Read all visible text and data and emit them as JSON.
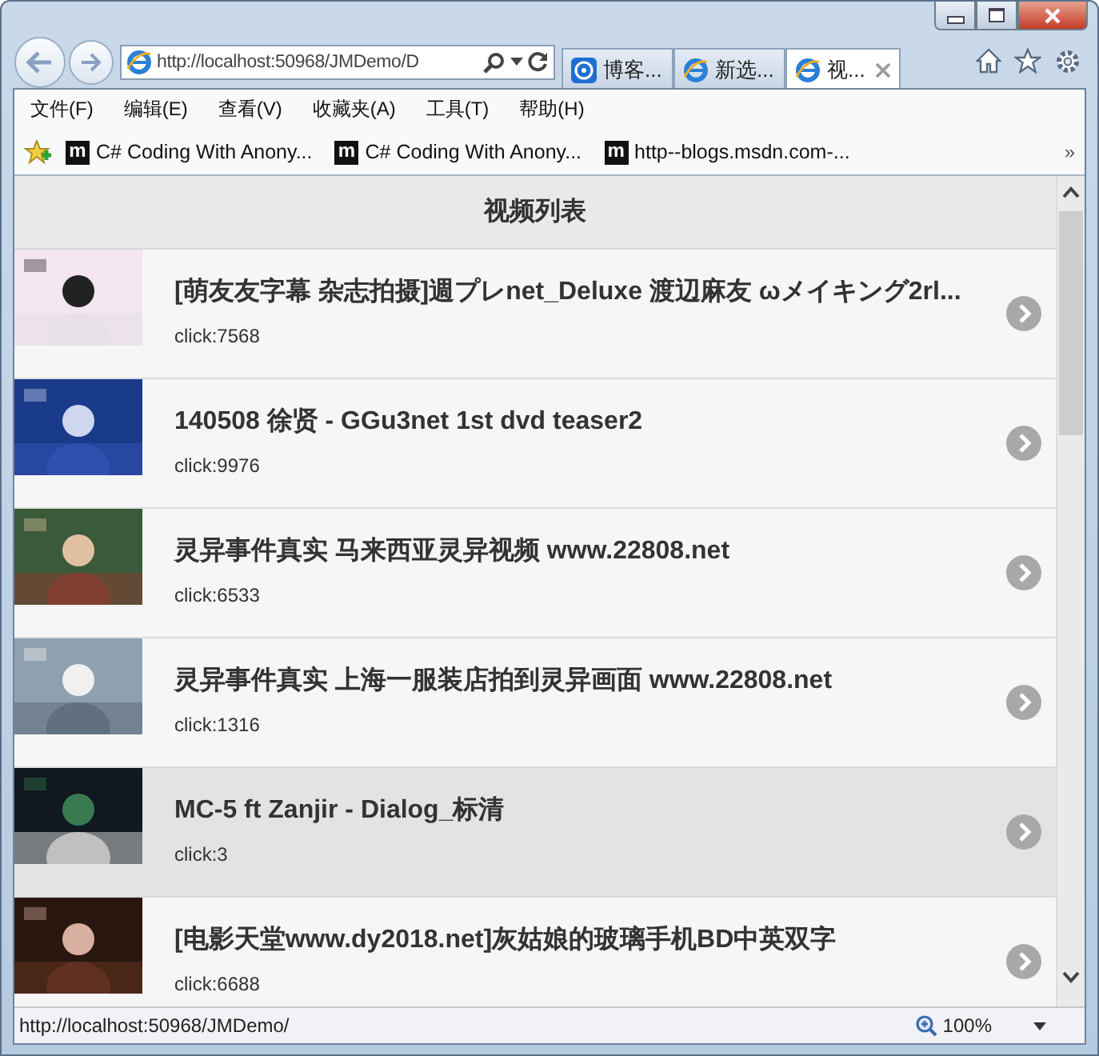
{
  "address_bar": {
    "value": "http://localhost:50968/JMDemo/D"
  },
  "tabs": [
    {
      "label": "博客...",
      "kind": "site",
      "selected": false
    },
    {
      "label": "新选...",
      "kind": "ie",
      "selected": false
    },
    {
      "label": "视...",
      "kind": "ie",
      "selected": true
    }
  ],
  "menu": [
    "文件(F)",
    "编辑(E)",
    "查看(V)",
    "收藏夹(A)",
    "工具(T)",
    "帮助(H)"
  ],
  "favorites": {
    "items": [
      {
        "icon": "m",
        "label": "C# Coding With Anony..."
      },
      {
        "icon": "m",
        "label": "C# Coding With Anony..."
      },
      {
        "icon": "m",
        "label": "http--blogs.msdn.com-..."
      }
    ],
    "overflow": "»"
  },
  "page": {
    "title": "视频列表",
    "videos": [
      {
        "title": "[萌友友字幕 杂志拍摄]週プレnet_Deluxe 渡辺麻友 ωメイキング2rl...",
        "clicks": "click:7568",
        "highlighted": false
      },
      {
        "title": "140508 徐贤 - GGu3net 1st dvd teaser2",
        "clicks": "click:9976",
        "highlighted": false
      },
      {
        "title": "灵异事件真实 马来西亚灵异视频 www.22808.net",
        "clicks": "click:6533",
        "highlighted": false
      },
      {
        "title": "灵异事件真实 上海一服装店拍到灵异画面 www.22808.net",
        "clicks": "click:1316",
        "highlighted": false
      },
      {
        "title": "MC-5 ft Zanjir - Dialog_标清",
        "clicks": "click:3",
        "highlighted": true
      },
      {
        "title": "[电影天堂www.dy2018.net]灰姑娘的玻璃手机BD中英双字",
        "clicks": "click:6688",
        "highlighted": false
      }
    ]
  },
  "status_bar": {
    "url": "http://localhost:50968/JMDemo/",
    "zoom": "100%"
  }
}
